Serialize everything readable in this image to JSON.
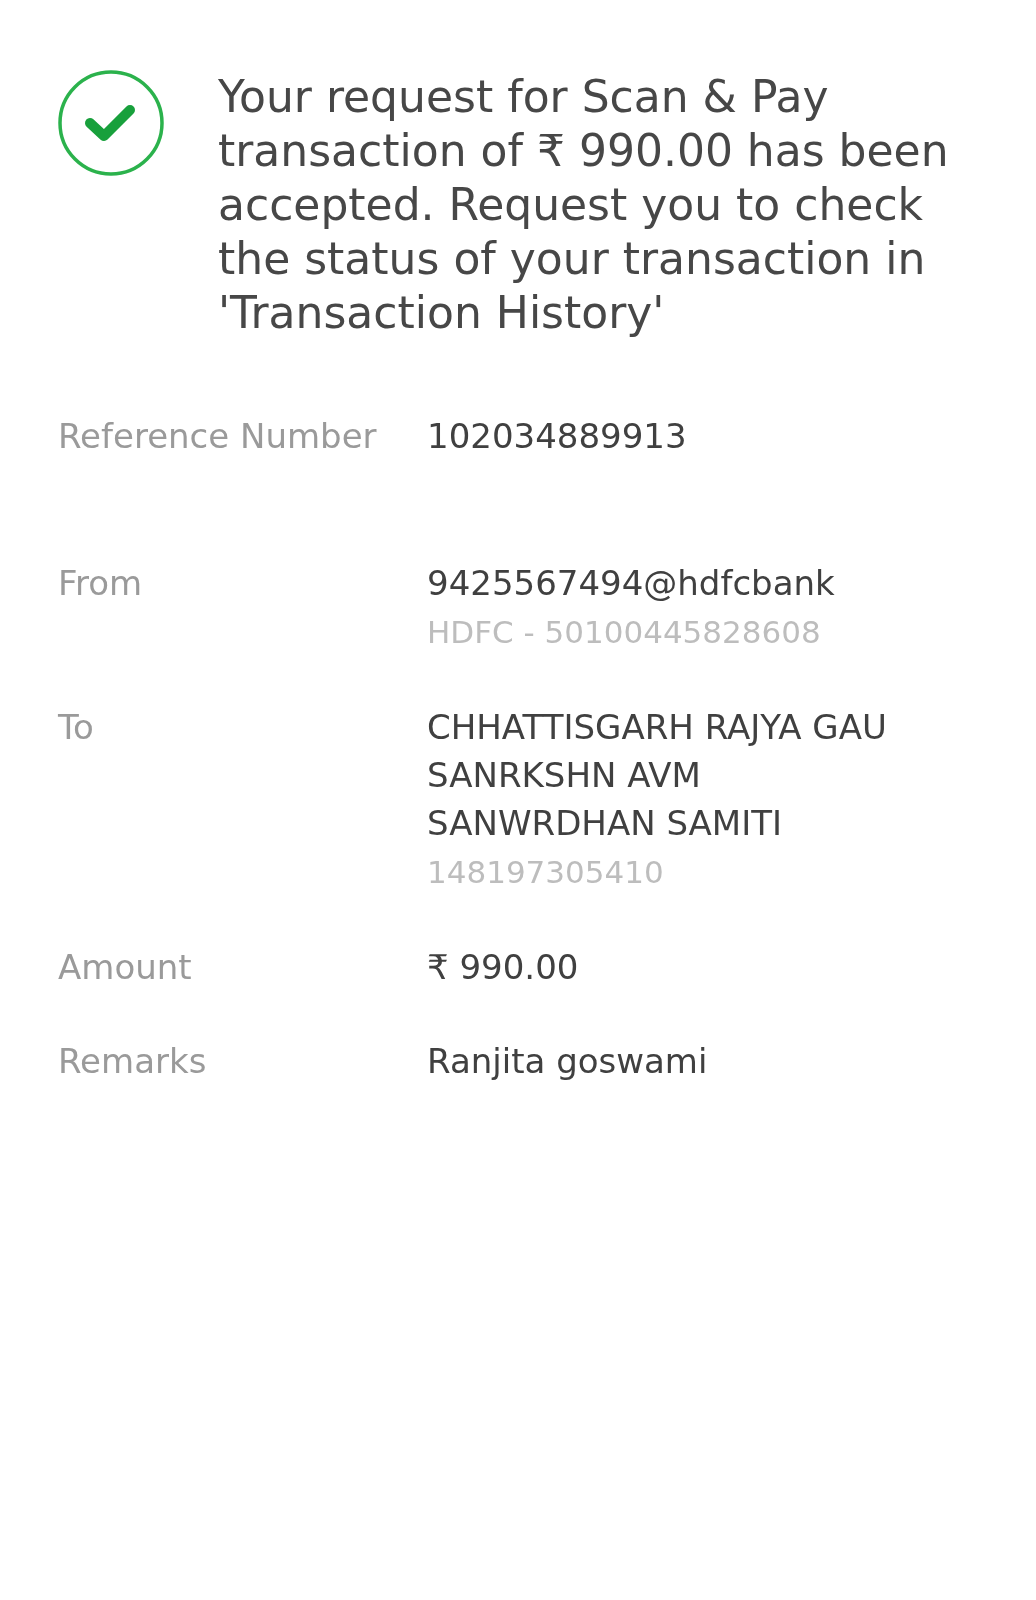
{
  "status": {
    "kind": "success",
    "message": "Your request for Scan & Pay transaction of ₹ 990.00 has been accepted. Request you to check the status of your transaction in 'Transaction History'"
  },
  "details": [
    {
      "label": "Reference Number",
      "value": "102034889913"
    },
    {
      "label": "From",
      "value": "9425567494@hdfcbank",
      "sub": "HDFC - 50100445828608"
    },
    {
      "label": "To",
      "value": "CHHATTISGARH RAJYA GAU SANRKSHN AVM SANWRDHAN SAMITI",
      "sub": "148197305410"
    },
    {
      "label": "Amount",
      "value": "₹ 990.00"
    },
    {
      "label": "Remarks",
      "value": "Ranjita goswami"
    }
  ]
}
